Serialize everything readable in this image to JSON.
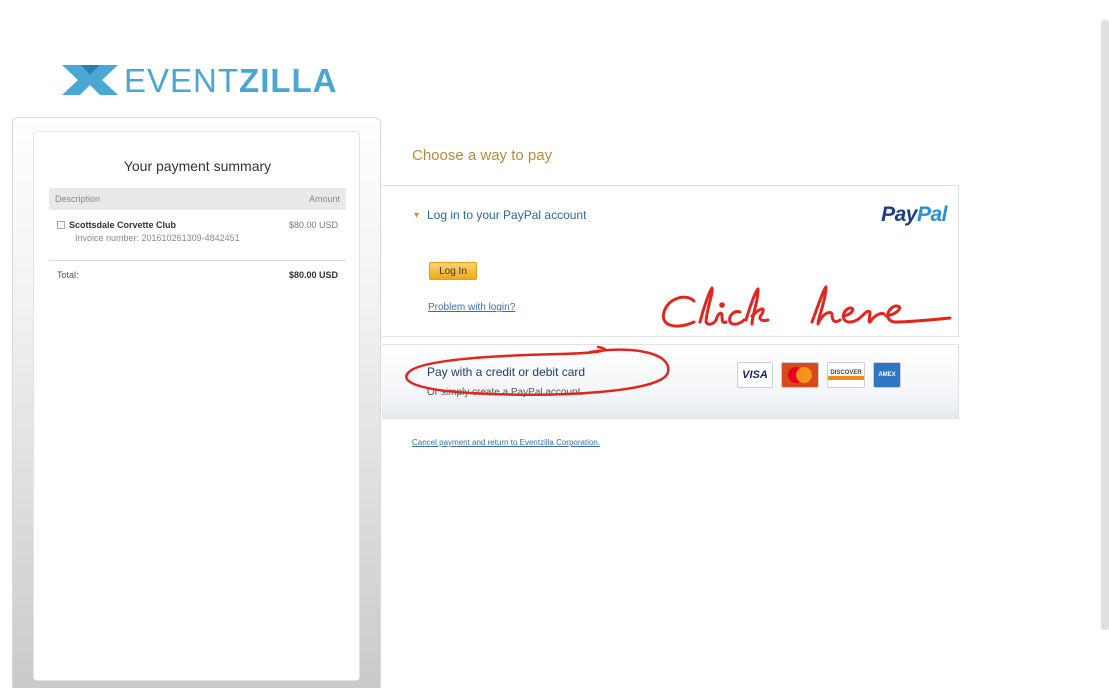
{
  "brand": {
    "logo_text_light": "EVENT",
    "logo_text_bold": "ZILLA",
    "color": "#4aa6d3"
  },
  "summary": {
    "title": "Your payment summary",
    "col_description": "Description",
    "col_amount": "Amount",
    "item": {
      "name": "Scottsdale Corvette Club",
      "amount": "$80.00 USD",
      "invoice": "Invoice number: 201610261309-4842451"
    },
    "total_label": "Total:",
    "total_value": "$80.00 USD"
  },
  "payment": {
    "choose_title": "Choose a way to pay",
    "paypal_login_title": "Log in to your PayPal account",
    "paypal_logo_a": "Pay",
    "paypal_logo_b": "Pal",
    "login_button": "Log In",
    "problem_link": "Problem with login?",
    "card_title": "Pay with a credit or debit card",
    "card_subtitle": "Or simply create a PayPal account.",
    "cards": [
      "VISA",
      "MasterCard",
      "DISCOVER",
      "AMEX"
    ],
    "cancel_link": "Cancel payment and return to Eventzilla Corporation."
  },
  "annotation": {
    "handwritten": "Click here",
    "color": "#e0261f"
  }
}
